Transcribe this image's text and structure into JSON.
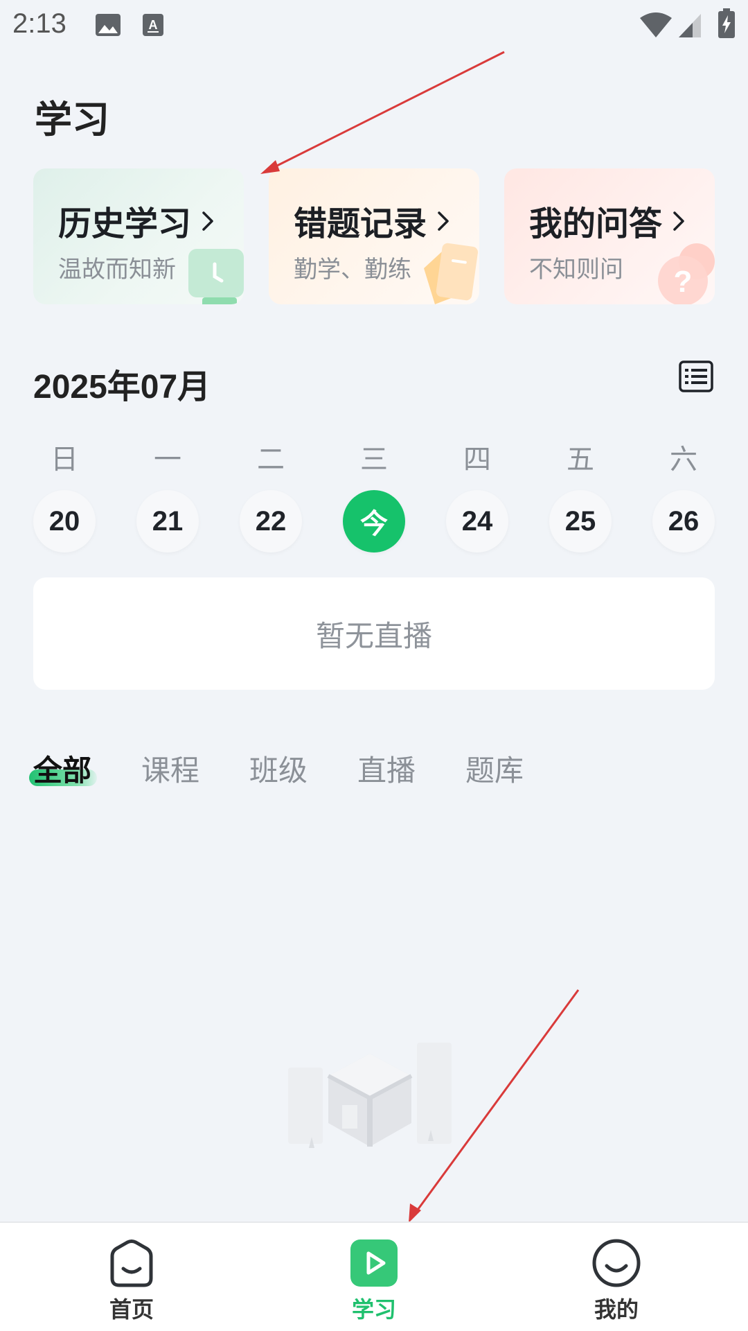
{
  "status_bar": {
    "time": "2:13"
  },
  "page": {
    "title": "学习"
  },
  "cards": [
    {
      "title": "历史学习",
      "subtitle": "温故而知新"
    },
    {
      "title": "错题记录",
      "subtitle": "勤学、勤练"
    },
    {
      "title": "我的问答",
      "subtitle": "不知则问"
    }
  ],
  "calendar": {
    "month": "2025年07月",
    "weekdays": [
      "日",
      "一",
      "二",
      "三",
      "四",
      "五",
      "六"
    ],
    "days": [
      "20",
      "21",
      "22",
      "今",
      "24",
      "25",
      "26"
    ],
    "today_index": 3
  },
  "live": {
    "empty_text": "暂无直播"
  },
  "tabs": [
    "全部",
    "课程",
    "班级",
    "直播",
    "题库"
  ],
  "active_tab": 0,
  "bottom_nav": [
    {
      "label": "首页",
      "icon": "home-face-icon"
    },
    {
      "label": "学习",
      "icon": "play-icon"
    },
    {
      "label": "我的",
      "icon": "smile-face-icon"
    }
  ],
  "active_nav": 1,
  "colors": {
    "accent": "#16c26b",
    "background": "#f1f4f8",
    "muted_text": "#8b9097",
    "annotation": "#d93a3a"
  }
}
